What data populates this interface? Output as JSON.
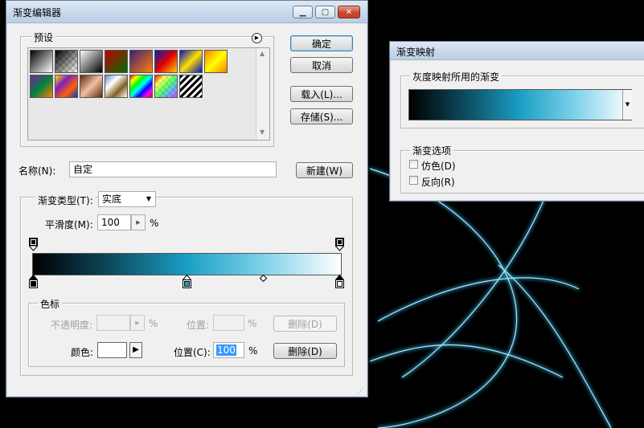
{
  "gradient_editor": {
    "title": "渐变编辑器",
    "presets_label": "预设",
    "ok_label": "确定",
    "cancel_label": "取消",
    "load_label": "载入(L)...",
    "save_label": "存储(S)...",
    "name_label": "名称(N):",
    "name_value": "自定",
    "new_label": "新建(W)",
    "gradient_type_label": "渐变类型(T):",
    "gradient_type_value": "实底",
    "smoothness_label": "平滑度(M):",
    "smoothness_value": "100",
    "percent": "%",
    "stops_label": "色标",
    "opacity_label": "不透明度:",
    "opacity_percent": "%",
    "opacity_location_label": "位置:",
    "opacity_location_percent": "%",
    "opacity_delete_label": "删除(D)",
    "color_label": "颜色:",
    "color_location_label": "位置(C):",
    "color_location_value": "100",
    "color_location_percent": "%",
    "color_delete_label": "删除(D)",
    "gradient_colors": [
      "#000000",
      "#1a9fc4",
      "#ffffff"
    ],
    "preset_swatches": [
      "black-white",
      "transparent-checker",
      "black-white-2",
      "red-green",
      "violet-orange",
      "blue-red-yellow",
      "blue-yellow-blue",
      "orange-yellow",
      "violet-green-orange",
      "yellow-violet-orange-blue",
      "copper",
      "chrome",
      "spectrum",
      "transparent-rainbow",
      "transparent-stripes"
    ]
  },
  "gradient_map": {
    "title": "渐变映射",
    "gradient_group_label": "灰度映射所用的渐变",
    "options_label": "渐变选项",
    "dither_label": "仿色(D)",
    "reverse_label": "反向(R)"
  }
}
